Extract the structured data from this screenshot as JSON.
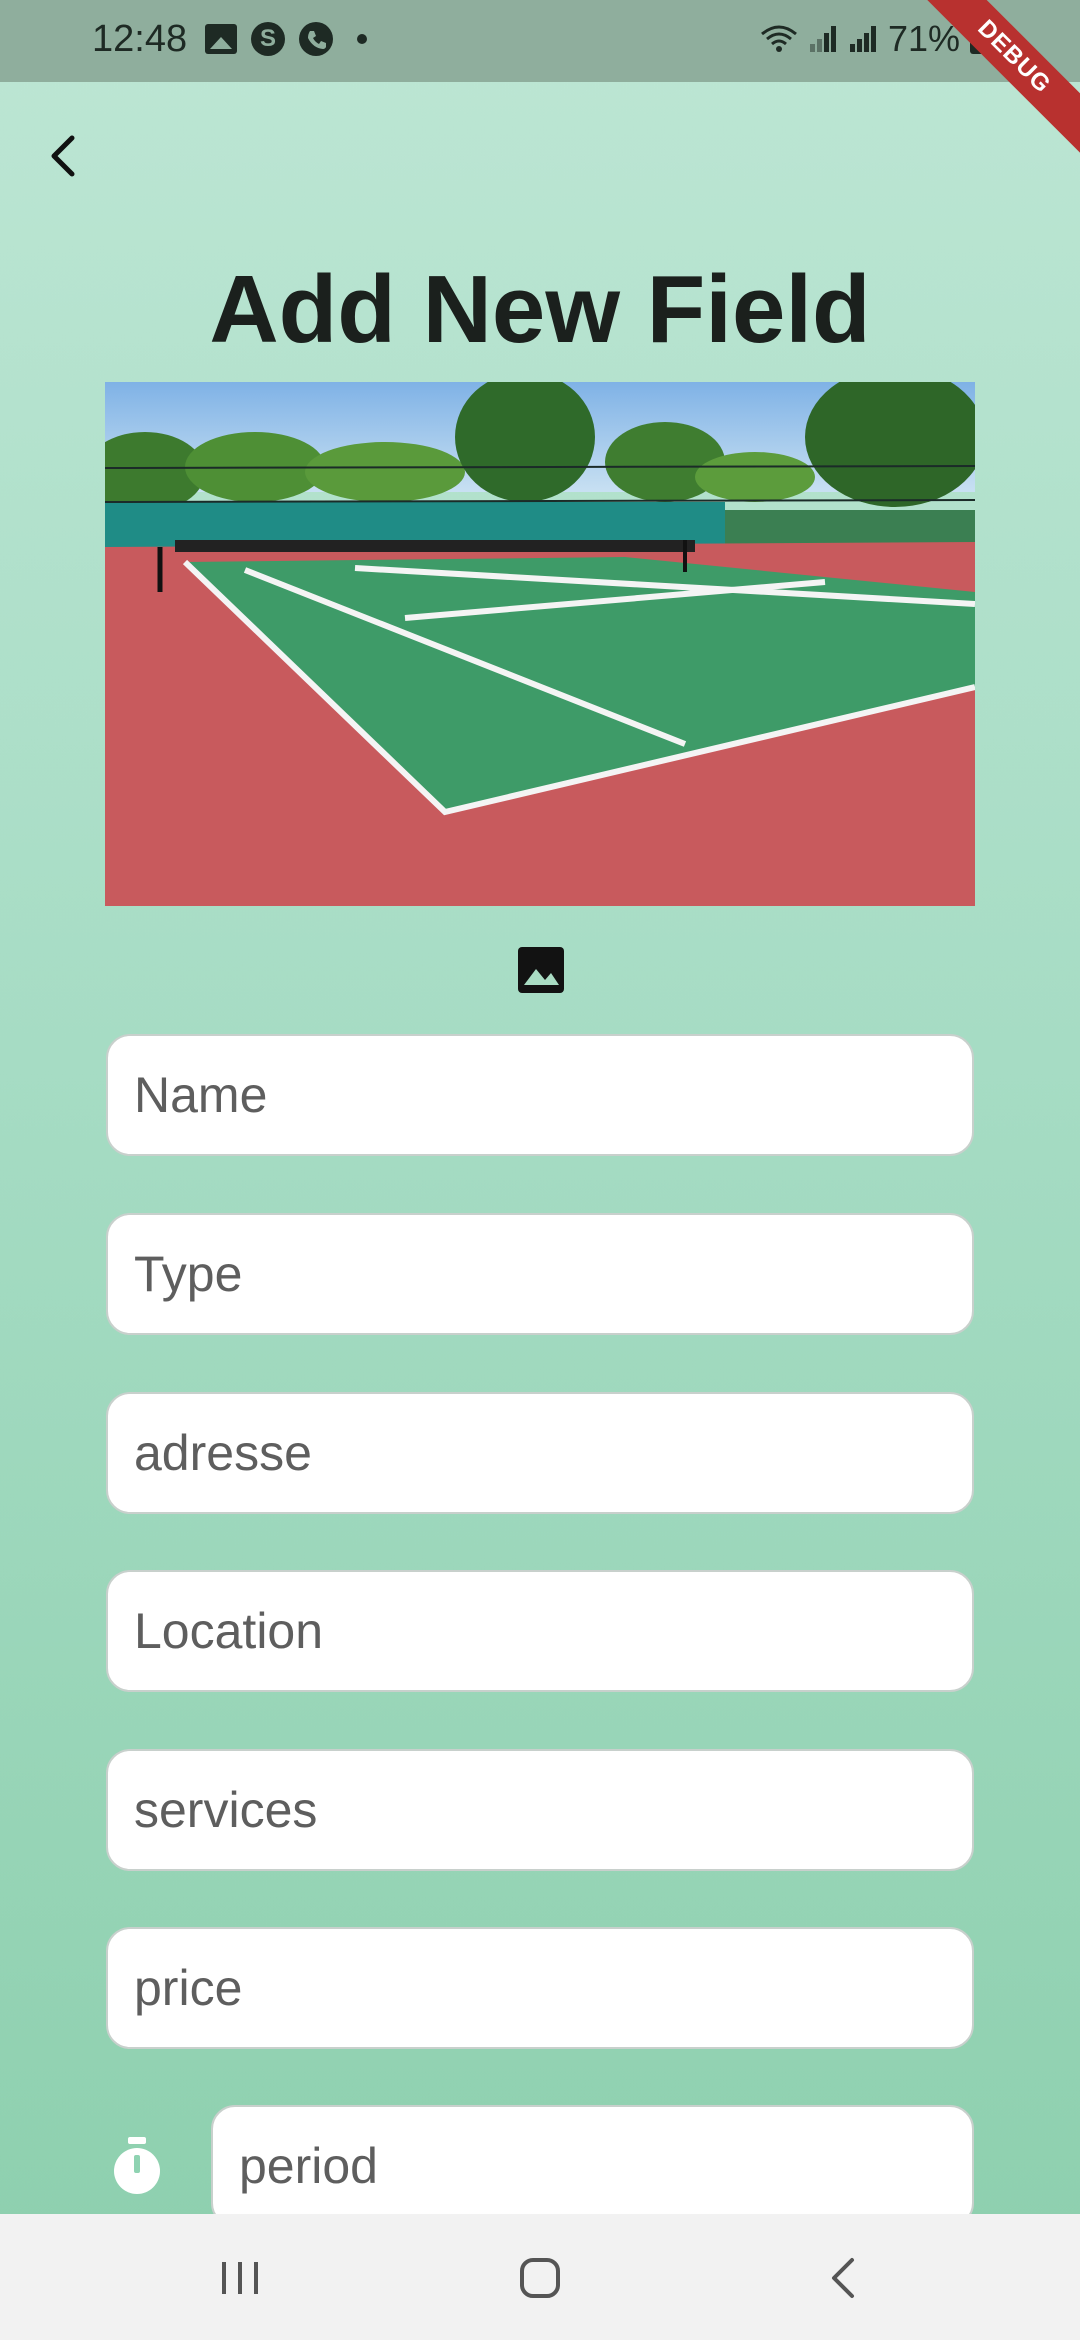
{
  "status_bar": {
    "time": "12:48",
    "battery": "71%",
    "debug_banner": "DEBUG",
    "icons": [
      "gallery-icon",
      "s-app-icon",
      "phone-icon",
      "dot-icon",
      "wifi-icon",
      "signal-icon",
      "signal-icon",
      "battery-charging-icon"
    ]
  },
  "header": {
    "back_icon": "chevron-left-icon",
    "title": "Add New Field"
  },
  "image": {
    "description_icon": "image-icon"
  },
  "form": {
    "name_placeholder": "Name",
    "type_placeholder": "Type",
    "adresse_placeholder": "adresse",
    "location_placeholder": "Location",
    "services_placeholder": "services",
    "price_placeholder": "price",
    "period_placeholder": "period",
    "period_icon": "timer-icon"
  },
  "nav": {
    "icons": [
      "recent-apps-icon",
      "home-icon",
      "back-icon"
    ]
  },
  "colors": {
    "background_top": "#bde6d4",
    "background_bottom": "#8ccfad",
    "debug_ribbon": "#b8312f"
  }
}
